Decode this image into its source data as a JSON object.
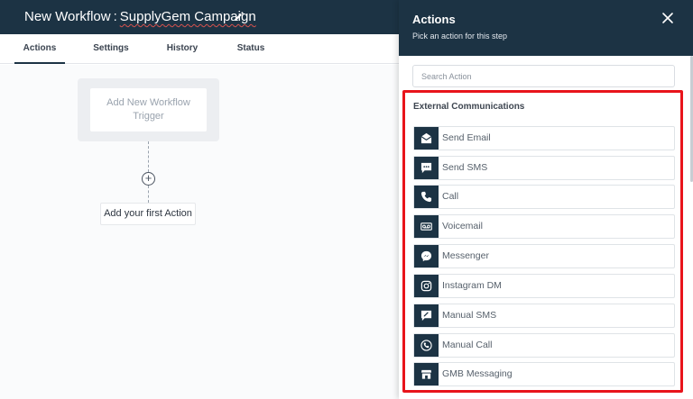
{
  "header": {
    "title_prefix": "New Workflow",
    "title_separator": ":",
    "workflow_name": "SupplyGem Campaign",
    "edit_icon": "pencil-icon"
  },
  "tabs": [
    {
      "label": "Actions",
      "active": true
    },
    {
      "label": "Settings",
      "active": false
    },
    {
      "label": "History",
      "active": false
    },
    {
      "label": "Status",
      "active": false
    }
  ],
  "canvas": {
    "trigger_label": "Add New Workflow Trigger",
    "add_icon": "plus-circle-icon",
    "first_action_label": "Add your first Action"
  },
  "panel": {
    "title": "Actions",
    "subtitle": "Pick an action for this step",
    "close_icon": "close-icon",
    "search_placeholder": "Search Action",
    "section_title": "External Communications",
    "highlight_color": "#e8141b",
    "accent_color": "#1c3344",
    "actions": [
      {
        "label": "Send Email",
        "icon": "envelope-icon"
      },
      {
        "label": "Send SMS",
        "icon": "chat-bubble-icon"
      },
      {
        "label": "Call",
        "icon": "phone-icon"
      },
      {
        "label": "Voicemail",
        "icon": "voicemail-icon"
      },
      {
        "label": "Messenger",
        "icon": "messenger-icon"
      },
      {
        "label": "Instagram DM",
        "icon": "instagram-icon"
      },
      {
        "label": "Manual SMS",
        "icon": "manual-sms-icon"
      },
      {
        "label": "Manual Call",
        "icon": "manual-call-icon"
      },
      {
        "label": "GMB Messaging",
        "icon": "gmb-store-icon"
      }
    ]
  }
}
